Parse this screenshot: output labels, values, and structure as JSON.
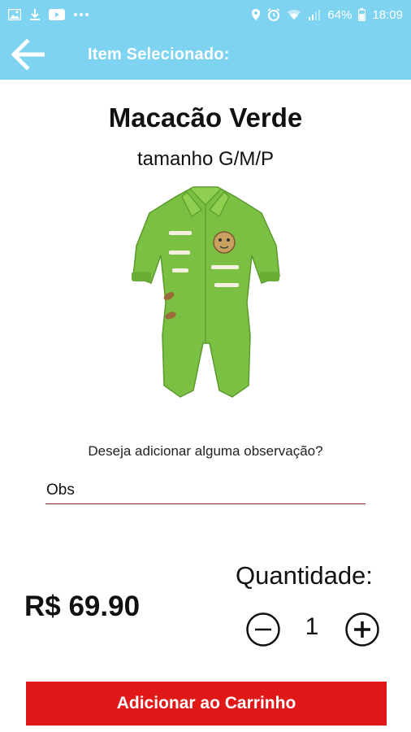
{
  "status_bar": {
    "battery": "64%",
    "time": "18:09",
    "left_icons": [
      "image-icon",
      "download-icon",
      "youtube-icon",
      "more-icon"
    ],
    "right_icons": [
      "location-icon",
      "alarm-icon",
      "wifi-icon",
      "signal-icon",
      "battery-icon"
    ]
  },
  "header": {
    "title": "Item Selecionado:",
    "back_icon": "arrow-left-icon",
    "color": "#7dd3f0"
  },
  "product": {
    "name": "Macacão Verde",
    "size": "tamanho G/M/P",
    "image": "green-baby-romper"
  },
  "observation": {
    "question": "Deseja adicionar alguma observação?",
    "value": "Obs"
  },
  "price": "R$ 69.90",
  "quantity": {
    "label": "Quantidade:",
    "value": "1"
  },
  "cart_button": {
    "label": "Adicionar ao Carrinho",
    "color": "#e01818"
  }
}
